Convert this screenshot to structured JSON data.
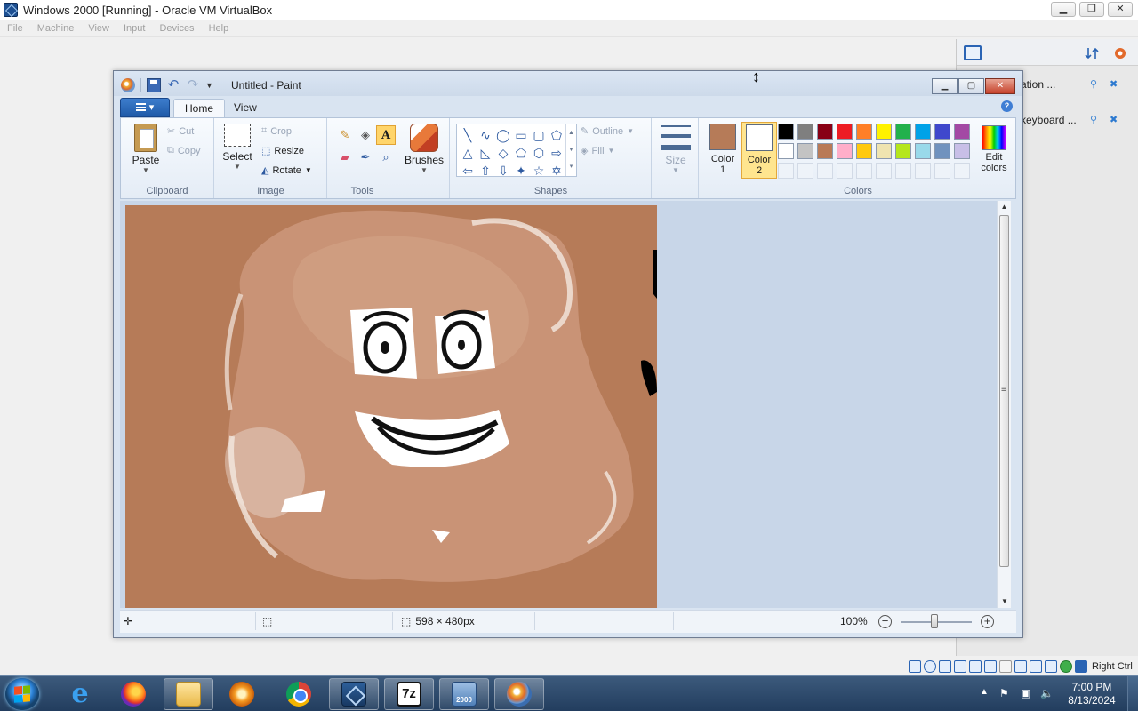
{
  "host": {
    "title": "Windows 2000 [Running] - Oracle VM VirtualBox",
    "menu": [
      "File",
      "Machine",
      "View",
      "Input",
      "Devices",
      "Help"
    ],
    "status_host_key": "Right Ctrl"
  },
  "side_panel": {
    "rows": [
      {
        "text": "ation ..."
      },
      {
        "text": "keyboard ..."
      }
    ]
  },
  "paint": {
    "title": "Untitled - Paint",
    "tabs": {
      "home": "Home",
      "view": "View"
    },
    "help_icon": "?",
    "clipboard": {
      "paste": "Paste",
      "cut": "Cut",
      "copy": "Copy",
      "group": "Clipboard"
    },
    "image": {
      "select": "Select",
      "crop": "Crop",
      "resize": "Resize",
      "rotate": "Rotate",
      "group": "Image"
    },
    "tools": {
      "group": "Tools",
      "items": [
        "pencil-icon",
        "fill-icon",
        "text-icon",
        "eraser-icon",
        "color-picker-icon",
        "magnifier-icon"
      ],
      "active": "text-icon"
    },
    "brushes": {
      "label": "Brushes"
    },
    "shapes": {
      "group": "Shapes",
      "outline": "Outline",
      "fill": "Fill",
      "glyphs": [
        "╲",
        "∿",
        "◯",
        "▭",
        "▢",
        "⬠",
        "△",
        "◺",
        "◇",
        "⬠",
        "⬡",
        "⇨",
        "⇦",
        "⇧",
        "⇩",
        "✦",
        "☆",
        "✡"
      ]
    },
    "size": {
      "label": "Size"
    },
    "colors": {
      "group": "Colors",
      "color1": {
        "label_line1": "Color",
        "label_line2": "1",
        "value": "#b67b58"
      },
      "color2": {
        "label_line1": "Color",
        "label_line2": "2",
        "value": "#ffffff"
      },
      "palette": [
        "#000000",
        "#7f7f7f",
        "#880015",
        "#ed1c24",
        "#ff7f27",
        "#fff200",
        "#22b14c",
        "#00a2e8",
        "#3f48cc",
        "#a349a4",
        "#ffffff",
        "#c3c3c3",
        "#b97a57",
        "#ffaec9",
        "#ffc90e",
        "#efe4b0",
        "#b5e61d",
        "#99d9ea",
        "#7092be",
        "#c8bfe7"
      ],
      "edit_line1": "Edit",
      "edit_line2": "colors"
    },
    "status": {
      "dimensions": "598 × 480px",
      "zoom": "100%"
    },
    "accent": "#b67b58"
  },
  "taskbar": {
    "items": [
      "internet-explorer",
      "firefox",
      "file-explorer",
      "media-player",
      "chrome",
      "virtualbox",
      "7-zip",
      "windows-2000-vm",
      "paint"
    ],
    "seven_zip_label": "7z",
    "w2k_label": "2000",
    "ie_glyph": "e",
    "time": "7:00 PM",
    "date": "8/13/2024"
  }
}
